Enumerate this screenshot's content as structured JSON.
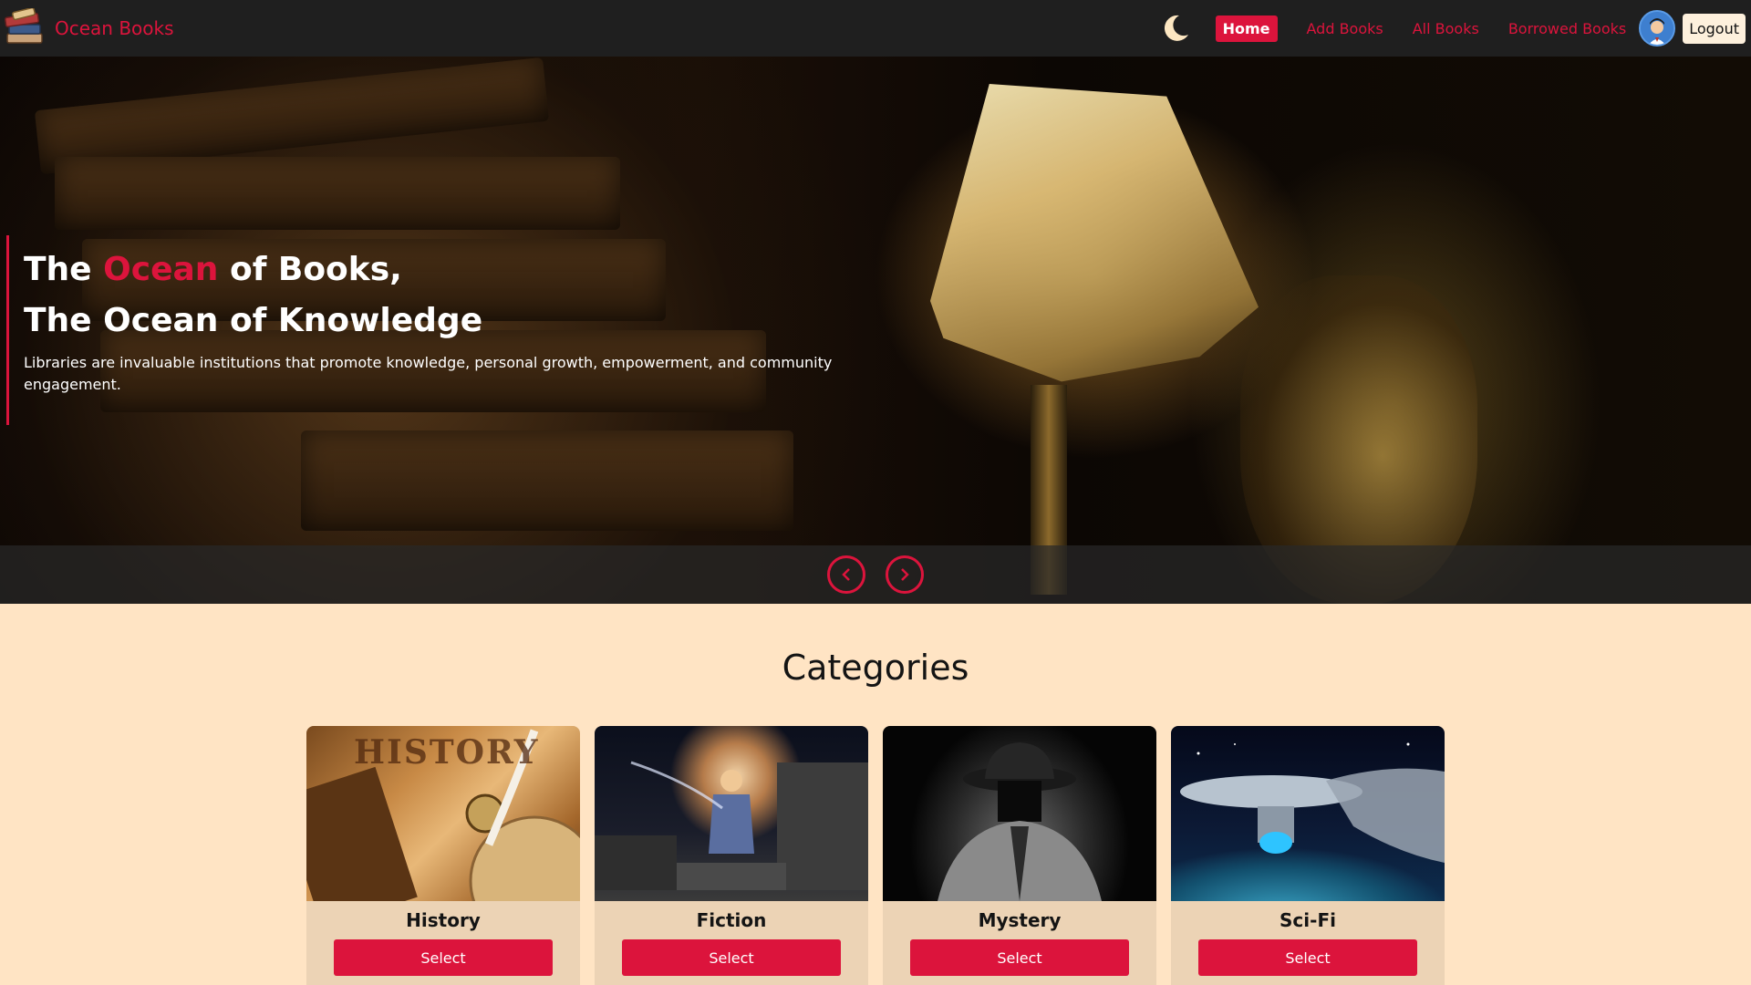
{
  "brand": {
    "name": "Ocean Books"
  },
  "nav": {
    "links": [
      {
        "label": "Home",
        "active": true
      },
      {
        "label": "Add Books",
        "active": false
      },
      {
        "label": "All Books",
        "active": false
      },
      {
        "label": "Borrowed Books",
        "active": false
      }
    ],
    "logout_label": "Logout",
    "theme_icon": "moon-icon",
    "avatar_icon": "user-avatar"
  },
  "hero": {
    "title_line1_pre": "The ",
    "title_line1_accent": "Ocean",
    "title_line1_post": " of Books,",
    "title_line2": "The Ocean of Knowledge",
    "description": "Libraries are invaluable institutions that promote knowledge, personal growth, empowerment, and community engagement.",
    "prev_icon": "chevron-left-icon",
    "next_icon": "chevron-right-icon"
  },
  "categories": {
    "heading": "Categories",
    "items": [
      {
        "name": "History",
        "button": "Select",
        "image_word": "HISTORY"
      },
      {
        "name": "Fiction",
        "button": "Select"
      },
      {
        "name": "Mystery",
        "button": "Select"
      },
      {
        "name": "Sci-Fi",
        "button": "Select"
      }
    ]
  },
  "colors": {
    "accent": "#dc143c",
    "navbar_bg": "#1f1f1f",
    "page_bg": "#ffe4c4",
    "card_bg": "#ecd3b5"
  }
}
